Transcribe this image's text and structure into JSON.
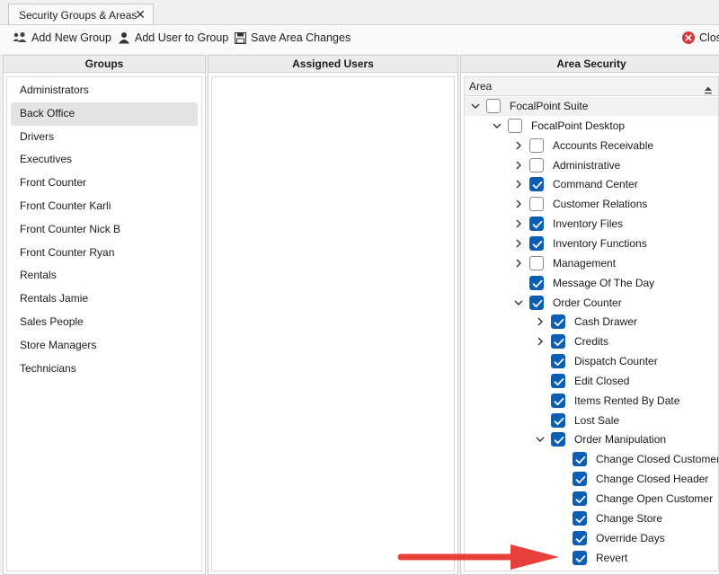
{
  "window": {
    "tab_label": "Security Groups & Areas",
    "tab_close": "✕"
  },
  "toolbar": {
    "add_group": "Add New Group",
    "add_user": "Add User to Group",
    "save_changes": "Save Area Changes",
    "close": "Close"
  },
  "groups": {
    "header": "Groups",
    "items": [
      {
        "label": "Administrators",
        "selected": false
      },
      {
        "label": "Back Office",
        "selected": true
      },
      {
        "label": "Drivers",
        "selected": false
      },
      {
        "label": "Executives",
        "selected": false
      },
      {
        "label": "Front Counter",
        "selected": false
      },
      {
        "label": "Front Counter Karli",
        "selected": false
      },
      {
        "label": "Front Counter Nick B",
        "selected": false
      },
      {
        "label": "Front Counter Ryan",
        "selected": false
      },
      {
        "label": "Rentals",
        "selected": false
      },
      {
        "label": "Rentals Jamie",
        "selected": false
      },
      {
        "label": "Sales People",
        "selected": false
      },
      {
        "label": "Store Managers",
        "selected": false
      },
      {
        "label": "Technicians",
        "selected": false
      }
    ]
  },
  "assigned_users": {
    "header": "Assigned Users"
  },
  "area_security": {
    "header": "Area Security",
    "column": "Area",
    "nodes": [
      {
        "label": "FocalPoint Suite",
        "level": 0,
        "expander": "expanded",
        "checked": false
      },
      {
        "label": "FocalPoint Desktop",
        "level": 1,
        "expander": "expanded",
        "checked": false
      },
      {
        "label": "Accounts Receivable",
        "level": 2,
        "expander": "collapsed",
        "checked": false
      },
      {
        "label": "Administrative",
        "level": 2,
        "expander": "collapsed",
        "checked": false
      },
      {
        "label": "Command Center",
        "level": 2,
        "expander": "collapsed",
        "checked": true
      },
      {
        "label": "Customer Relations",
        "level": 2,
        "expander": "collapsed",
        "checked": false
      },
      {
        "label": "Inventory Files",
        "level": 2,
        "expander": "collapsed",
        "checked": true
      },
      {
        "label": "Inventory Functions",
        "level": 2,
        "expander": "collapsed",
        "checked": true
      },
      {
        "label": "Management",
        "level": 2,
        "expander": "collapsed",
        "checked": false
      },
      {
        "label": "Message Of The Day",
        "level": 2,
        "expander": "none",
        "checked": true
      },
      {
        "label": "Order Counter",
        "level": 2,
        "expander": "expanded",
        "checked": true
      },
      {
        "label": "Cash Drawer",
        "level": 3,
        "expander": "collapsed",
        "checked": true
      },
      {
        "label": "Credits",
        "level": 3,
        "expander": "collapsed",
        "checked": true
      },
      {
        "label": "Dispatch Counter",
        "level": 3,
        "expander": "none",
        "checked": true
      },
      {
        "label": "Edit Closed",
        "level": 3,
        "expander": "none",
        "checked": true
      },
      {
        "label": "Items Rented By Date",
        "level": 3,
        "expander": "none",
        "checked": true
      },
      {
        "label": "Lost Sale",
        "level": 3,
        "expander": "none",
        "checked": true
      },
      {
        "label": "Order Manipulation",
        "level": 3,
        "expander": "expanded",
        "checked": true
      },
      {
        "label": "Change Closed Customer",
        "level": 4,
        "expander": "none",
        "checked": true
      },
      {
        "label": "Change Closed Header",
        "level": 4,
        "expander": "none",
        "checked": true
      },
      {
        "label": "Change Open Customer",
        "level": 4,
        "expander": "none",
        "checked": true
      },
      {
        "label": "Change Store",
        "level": 4,
        "expander": "none",
        "checked": true
      },
      {
        "label": "Override Days",
        "level": 4,
        "expander": "none",
        "checked": true
      },
      {
        "label": "Revert",
        "level": 4,
        "expander": "none",
        "checked": true
      }
    ]
  },
  "colors": {
    "checkbox_on": "#0a5fb4",
    "annotation_arrow": "#e8403a",
    "close_icon": "#d9363e"
  }
}
